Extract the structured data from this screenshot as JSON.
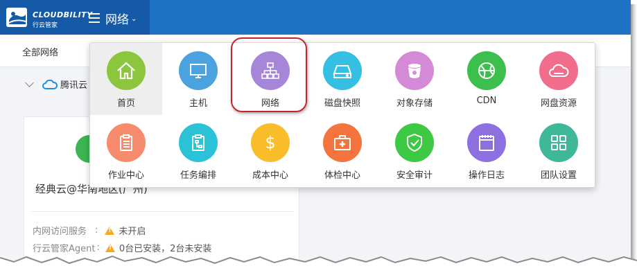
{
  "brand": {
    "name": "CLOUDBILITY",
    "subtitle": "行云管家"
  },
  "header": {
    "menu_title": "网络"
  },
  "subbar": {
    "all_networks": "全部网络"
  },
  "provider": {
    "name": "腾讯云"
  },
  "card": {
    "title": "经典云@华南地区(广州)",
    "rows": [
      {
        "label": "内网访问服务",
        "separator": ":",
        "value": "未开启"
      },
      {
        "label": "行云管家Agent",
        "separator": ":",
        "value": "0台已安装，2台未安装"
      }
    ]
  },
  "menu": {
    "active": "首页",
    "highlighted": "网络",
    "items": [
      {
        "label": "首页",
        "icon": "home-icon",
        "color": "#8cc63f"
      },
      {
        "label": "主机",
        "icon": "monitor-icon",
        "color": "#4aa3df"
      },
      {
        "label": "网络",
        "icon": "network-icon",
        "color": "#a686d8"
      },
      {
        "label": "磁盘快照",
        "icon": "disk-icon",
        "color": "#35bfe3"
      },
      {
        "label": "对象存储",
        "icon": "bucket-icon",
        "color": "#d58ad8"
      },
      {
        "label": "CDN",
        "icon": "globe-icon",
        "color": "#3cbf4d"
      },
      {
        "label": "网盘资源",
        "icon": "cloud-icon",
        "color": "#f06e8c"
      },
      {
        "label": "作业中心",
        "icon": "clipboard-icon",
        "color": "#f68b6e"
      },
      {
        "label": "任务编排",
        "icon": "flow-clipboard-icon",
        "color": "#2bc2d8"
      },
      {
        "label": "成本中心",
        "icon": "dollar-icon",
        "color": "#f9bd2b"
      },
      {
        "label": "体检中心",
        "icon": "medical-kit-icon",
        "color": "#f3753d"
      },
      {
        "label": "安全审计",
        "icon": "shield-check-icon",
        "color": "#3ec944"
      },
      {
        "label": "操作日志",
        "icon": "calendar-log-icon",
        "color": "#8d6fe0"
      },
      {
        "label": "团队设置",
        "icon": "grid-settings-icon",
        "color": "#3fb89a"
      }
    ]
  },
  "colors": {
    "topbar": "#1f73c4",
    "logo_bg": "#155aa6",
    "highlight_border": "#c8232c",
    "warning": "#f7a81c"
  }
}
